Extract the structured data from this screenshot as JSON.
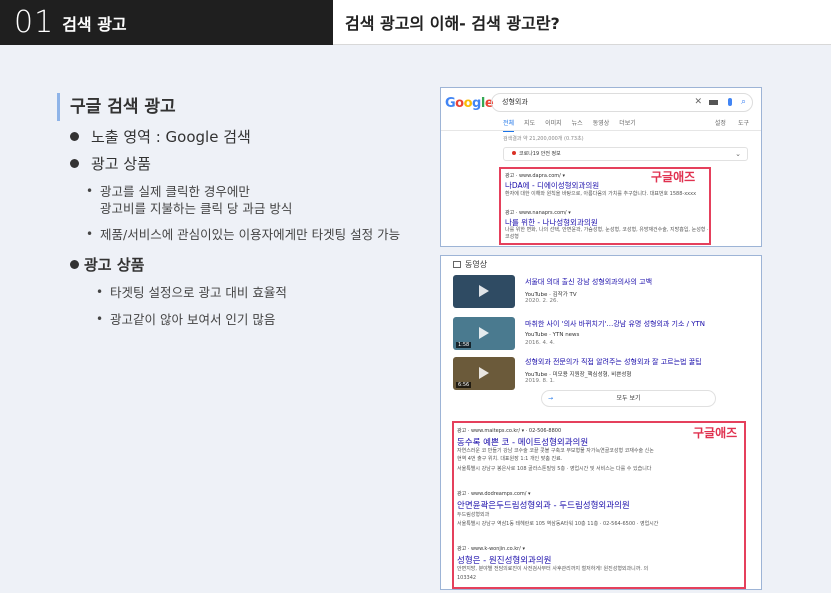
{
  "header": {
    "number": "01",
    "section_label": "검색 광고",
    "page_title": "검색 광고의 이해- 검색 광고란?"
  },
  "content": {
    "section_title": "구글 검색 광고",
    "bullet1": "노출 영역 : Google 검색",
    "bullet2": "광고 상품",
    "sub1_line1": "광고를 실제 클릭한 경우에만",
    "sub1_line2": "광고비를 지불하는 클릭 당 과금 방식",
    "sub2": "제품/서비스에 관심이있는 이용자에게만 타겟팅 설정 가능",
    "bullet3": "광고 상품",
    "sub3": "타겟팅 설정으로 광고 대비 효율적",
    "sub4": "광고같이 않아 보여서 인기 많음"
  },
  "screenshot1": {
    "logo": [
      "G",
      "o",
      "o",
      "g",
      "l",
      "e"
    ],
    "query": "성형외과",
    "tabs": [
      "전체",
      "지도",
      "이미지",
      "뉴스",
      "동영상",
      "더보기"
    ],
    "tabs_right": [
      "설정",
      "도구"
    ],
    "result_count": "검색결과 약 21,200,000개 (0.73초)",
    "corona": "코로나19 안전 정보",
    "ad_label": "구글애즈",
    "ad1_meta": "광고 · www.dapra.com/ ▾",
    "ad1_head": "나DA에 - 디에이성형외과의원",
    "ad1_desc": "환자에 대한 이해와 원칙을 바탕으로, 아름다움의 가치를 추구합니다. 대표번호 1588-xxxx",
    "ad2_meta": "광고 · www.nanaprs.com/ ▾",
    "ad2_head": "나를 위한 - 나나성형외과의원",
    "ad2_desc": "나를 위한 변화, 나의 선택, 안면윤곽, 가슴성형, 눈성형, 코성형, 유방재건수술, 지방흡입, 눈성형 · 코성형"
  },
  "screenshot2": {
    "video_header": "동영상",
    "videos": [
      {
        "title": "서울대 의대 출신 강남 성형외과의사의 고백",
        "source": "YouTube · 김작가 TV",
        "date": "2020. 2. 26."
      },
      {
        "title": "마취한 사이 '의사 바뀌치기'…강남 유명 성형외과 기소 / YTN",
        "source": "YouTube · YTN news",
        "date": "2016. 4. 4.",
        "duration": "1:58"
      },
      {
        "title": "성형외과 전문의가 직접 알려주는 성형외과 잘 고르는법 꿀팁",
        "source": "YouTube · 미모용 지원장_핵심성형, 비쁜성형",
        "date": "2019. 8. 1.",
        "duration": "6:56"
      }
    ],
    "more_label": "모두 보기",
    "ad_label": "구글애즈",
    "ads": [
      {
        "meta": "광고 · www.maiteps.co.kr/ ▾ · 02-506-8800",
        "head": "동수록 예쁜 코 - 메이트성형외과의원",
        "desc1": "자연스러운 코 만들기 강남 코수술 코끝 콧볼 구축코 무보형물 자가늑연골코성형 코재수술 신논",
        "desc2": "현역 4번 출구 위치. 대표원장 1:1 개인 맞춤 진료.",
        "addr": "서울특별시 강남구 봉은사로 108 골라스톤빌딩 5층 · 영업시간 및 서비스는 다를 수 있습니다"
      },
      {
        "meta": "광고 · www.dodreamps.com/ ▾",
        "head": "안면윤곽은두드림성형외과 - 두드림성형외과의원",
        "desc1": "두드림성형외과",
        "desc2": "",
        "addr": "서울특별시 강남구 역삼1동 테헤란로 105 역삼동A타워 10층 11층 · 02-564-6500 · 영업시간"
      },
      {
        "meta": "광고 · www.k-wonjin.co.kr/ ▾",
        "head": "성형은 - 원진성형외과의원",
        "desc1": "안면지방, 분야별 전담의료진이 사전검사부터 사후관리까지 철저하게! 원진성형외과니까. 의",
        "desc2": "103342",
        "addr": ""
      }
    ]
  }
}
